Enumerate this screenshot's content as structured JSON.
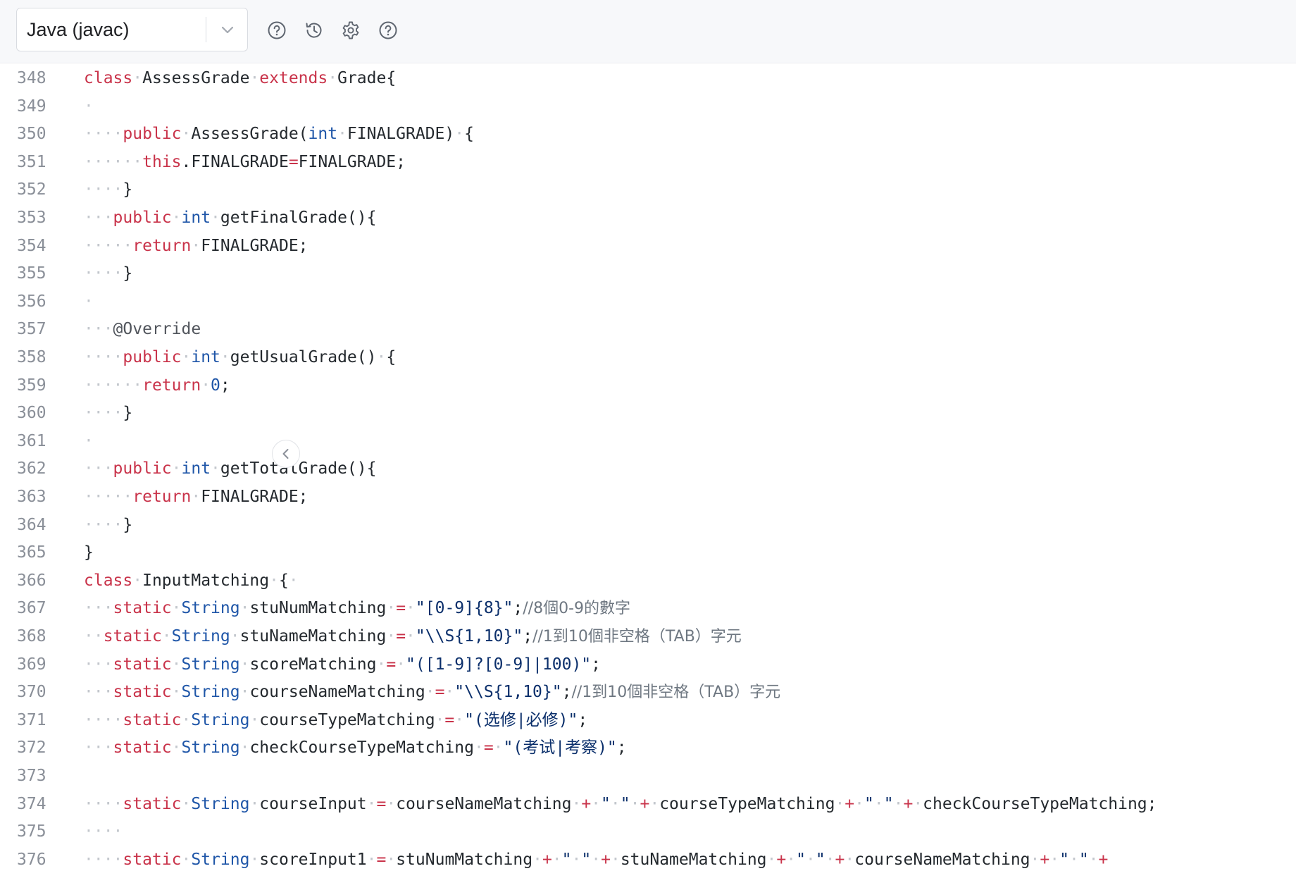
{
  "toolbar": {
    "language": "Java (javac)",
    "icons": [
      "help-circle-icon",
      "history-icon",
      "gear-icon",
      "question-icon"
    ]
  },
  "colors": {
    "keyword": "#c9334a",
    "type": "#1f56a8",
    "string": "#0b2f6b",
    "comment": "#6e7781",
    "whitespace": "#c3c7cd"
  },
  "editor": {
    "lines": [
      {
        "n": "348",
        "tokens": [
          [
            "kw",
            "class"
          ],
          [
            "ws",
            "·"
          ],
          [
            "pl",
            "AssessGrade"
          ],
          [
            "ws",
            "·"
          ],
          [
            "kw",
            "extends"
          ],
          [
            "ws",
            "·"
          ],
          [
            "pl",
            "Grade{"
          ]
        ]
      },
      {
        "n": "349",
        "tokens": [
          [
            "ws",
            "·"
          ]
        ]
      },
      {
        "n": "350",
        "tokens": [
          [
            "ws",
            "····"
          ],
          [
            "kw",
            "public"
          ],
          [
            "ws",
            "·"
          ],
          [
            "pl",
            "AssessGrade("
          ],
          [
            "ty",
            "int"
          ],
          [
            "ws",
            "·"
          ],
          [
            "pl",
            "FINALGRADE)"
          ],
          [
            "ws",
            "·"
          ],
          [
            "pl",
            "{"
          ]
        ]
      },
      {
        "n": "351",
        "tokens": [
          [
            "ws",
            "······"
          ],
          [
            "kw",
            "this"
          ],
          [
            "pl",
            ".FINALGRADE"
          ],
          [
            "op",
            "="
          ],
          [
            "pl",
            "FINALGRADE;"
          ]
        ]
      },
      {
        "n": "352",
        "tokens": [
          [
            "ws",
            "····"
          ],
          [
            "pl",
            "}"
          ]
        ]
      },
      {
        "n": "353",
        "tokens": [
          [
            "ws",
            "···"
          ],
          [
            "kw",
            "public"
          ],
          [
            "ws",
            "·"
          ],
          [
            "ty",
            "int"
          ],
          [
            "ws",
            "·"
          ],
          [
            "pl",
            "getFinalGrade(){"
          ]
        ]
      },
      {
        "n": "354",
        "tokens": [
          [
            "ws",
            "·····"
          ],
          [
            "kw",
            "return"
          ],
          [
            "ws",
            "·"
          ],
          [
            "pl",
            "FINALGRADE;"
          ]
        ]
      },
      {
        "n": "355",
        "tokens": [
          [
            "ws",
            "····"
          ],
          [
            "pl",
            "}"
          ]
        ]
      },
      {
        "n": "356",
        "tokens": [
          [
            "ws",
            "·"
          ]
        ]
      },
      {
        "n": "357",
        "tokens": [
          [
            "ws",
            "···"
          ],
          [
            "an",
            "@Override"
          ]
        ]
      },
      {
        "n": "358",
        "tokens": [
          [
            "ws",
            "····"
          ],
          [
            "kw",
            "public"
          ],
          [
            "ws",
            "·"
          ],
          [
            "ty",
            "int"
          ],
          [
            "ws",
            "·"
          ],
          [
            "pl",
            "getUsualGrade()"
          ],
          [
            "ws",
            "·"
          ],
          [
            "pl",
            "{"
          ]
        ]
      },
      {
        "n": "359",
        "tokens": [
          [
            "ws",
            "······"
          ],
          [
            "kw",
            "return"
          ],
          [
            "ws",
            "·"
          ],
          [
            "nu",
            "0"
          ],
          [
            "pl",
            ";"
          ]
        ]
      },
      {
        "n": "360",
        "tokens": [
          [
            "ws",
            "····"
          ],
          [
            "pl",
            "}"
          ]
        ]
      },
      {
        "n": "361",
        "tokens": [
          [
            "ws",
            "·"
          ]
        ]
      },
      {
        "n": "362",
        "tokens": [
          [
            "ws",
            "···"
          ],
          [
            "kw",
            "public"
          ],
          [
            "ws",
            "·"
          ],
          [
            "ty",
            "int"
          ],
          [
            "ws",
            "·"
          ],
          [
            "pl",
            "getTotalGrade(){"
          ]
        ]
      },
      {
        "n": "363",
        "tokens": [
          [
            "ws",
            "·····"
          ],
          [
            "kw",
            "return"
          ],
          [
            "ws",
            "·"
          ],
          [
            "pl",
            "FINALGRADE;"
          ]
        ]
      },
      {
        "n": "364",
        "tokens": [
          [
            "ws",
            "····"
          ],
          [
            "pl",
            "}"
          ]
        ]
      },
      {
        "n": "365",
        "tokens": [
          [
            "pl",
            "}"
          ]
        ]
      },
      {
        "n": "366",
        "tokens": [
          [
            "kw",
            "class"
          ],
          [
            "ws",
            "·"
          ],
          [
            "pl",
            "InputMatching"
          ],
          [
            "ws",
            "·"
          ],
          [
            "pl",
            "{"
          ],
          [
            "ws",
            "·"
          ]
        ]
      },
      {
        "n": "367",
        "tokens": [
          [
            "ws",
            "···"
          ],
          [
            "kw",
            "static"
          ],
          [
            "ws",
            "·"
          ],
          [
            "ty",
            "String"
          ],
          [
            "ws",
            "·"
          ],
          [
            "pl",
            "stuNumMatching"
          ],
          [
            "ws",
            "·"
          ],
          [
            "op",
            "="
          ],
          [
            "ws",
            "·"
          ],
          [
            "st",
            "\"[0-9]{8}\""
          ],
          [
            "pl",
            ";"
          ],
          [
            "cm",
            "//8個0-9的數字"
          ]
        ]
      },
      {
        "n": "368",
        "tokens": [
          [
            "ws",
            "··"
          ],
          [
            "kw",
            "static"
          ],
          [
            "ws",
            "·"
          ],
          [
            "ty",
            "String"
          ],
          [
            "ws",
            "·"
          ],
          [
            "pl",
            "stuNameMatching"
          ],
          [
            "ws",
            "·"
          ],
          [
            "op",
            "="
          ],
          [
            "ws",
            "·"
          ],
          [
            "st",
            "\"\\\\S{1,10}\""
          ],
          [
            "pl",
            ";"
          ],
          [
            "cm",
            "//1到10個非空格（TAB）字元"
          ]
        ]
      },
      {
        "n": "369",
        "tokens": [
          [
            "ws",
            "···"
          ],
          [
            "kw",
            "static"
          ],
          [
            "ws",
            "·"
          ],
          [
            "ty",
            "String"
          ],
          [
            "ws",
            "·"
          ],
          [
            "pl",
            "scoreMatching"
          ],
          [
            "ws",
            "·"
          ],
          [
            "op",
            "="
          ],
          [
            "ws",
            "·"
          ],
          [
            "st",
            "\"([1-9]?[0-9]|100)\""
          ],
          [
            "pl",
            ";"
          ]
        ]
      },
      {
        "n": "370",
        "tokens": [
          [
            "ws",
            "···"
          ],
          [
            "kw",
            "static"
          ],
          [
            "ws",
            "·"
          ],
          [
            "ty",
            "String"
          ],
          [
            "ws",
            "·"
          ],
          [
            "pl",
            "courseNameMatching"
          ],
          [
            "ws",
            "·"
          ],
          [
            "op",
            "="
          ],
          [
            "ws",
            "·"
          ],
          [
            "st",
            "\"\\\\S{1,10}\""
          ],
          [
            "pl",
            ";"
          ],
          [
            "cm",
            "//1到10個非空格（TAB）字元"
          ]
        ]
      },
      {
        "n": "371",
        "tokens": [
          [
            "ws",
            "····"
          ],
          [
            "kw",
            "static"
          ],
          [
            "ws",
            "·"
          ],
          [
            "ty",
            "String"
          ],
          [
            "ws",
            "·"
          ],
          [
            "pl",
            "courseTypeMatching"
          ],
          [
            "ws",
            "·"
          ],
          [
            "op",
            "="
          ],
          [
            "ws",
            "·"
          ],
          [
            "st",
            "\"(选修|必修)\""
          ],
          [
            "pl",
            ";"
          ]
        ]
      },
      {
        "n": "372",
        "tokens": [
          [
            "ws",
            "···"
          ],
          [
            "kw",
            "static"
          ],
          [
            "ws",
            "·"
          ],
          [
            "ty",
            "String"
          ],
          [
            "ws",
            "·"
          ],
          [
            "pl",
            "checkCourseTypeMatching"
          ],
          [
            "ws",
            "·"
          ],
          [
            "op",
            "="
          ],
          [
            "ws",
            "·"
          ],
          [
            "st",
            "\"(考试|考察)\""
          ],
          [
            "pl",
            ";"
          ]
        ]
      },
      {
        "n": "373",
        "tokens": []
      },
      {
        "n": "374",
        "tokens": [
          [
            "ws",
            "····"
          ],
          [
            "kw",
            "static"
          ],
          [
            "ws",
            "·"
          ],
          [
            "ty",
            "String"
          ],
          [
            "ws",
            "·"
          ],
          [
            "pl",
            "courseInput"
          ],
          [
            "ws",
            "·"
          ],
          [
            "op",
            "="
          ],
          [
            "ws",
            "·"
          ],
          [
            "pl",
            "courseNameMatching"
          ],
          [
            "ws",
            "·"
          ],
          [
            "op",
            "+"
          ],
          [
            "ws",
            "·"
          ],
          [
            "st",
            "\""
          ],
          [
            "ws",
            "·"
          ],
          [
            "st",
            "\""
          ],
          [
            "ws",
            "·"
          ],
          [
            "op",
            "+"
          ],
          [
            "ws",
            "·"
          ],
          [
            "pl",
            "courseTypeMatching"
          ],
          [
            "ws",
            "·"
          ],
          [
            "op",
            "+"
          ],
          [
            "ws",
            "·"
          ],
          [
            "st",
            "\""
          ],
          [
            "ws",
            "·"
          ],
          [
            "st",
            "\""
          ],
          [
            "ws",
            "·"
          ],
          [
            "op",
            "+"
          ],
          [
            "ws",
            "·"
          ],
          [
            "pl",
            "checkCourseTypeMatching;"
          ]
        ]
      },
      {
        "n": "375",
        "tokens": [
          [
            "ws",
            "····"
          ]
        ]
      },
      {
        "n": "376",
        "tokens": [
          [
            "ws",
            "····"
          ],
          [
            "kw",
            "static"
          ],
          [
            "ws",
            "·"
          ],
          [
            "ty",
            "String"
          ],
          [
            "ws",
            "·"
          ],
          [
            "pl",
            "scoreInput1"
          ],
          [
            "ws",
            "·"
          ],
          [
            "op",
            "="
          ],
          [
            "ws",
            "·"
          ],
          [
            "pl",
            "stuNumMatching"
          ],
          [
            "ws",
            "·"
          ],
          [
            "op",
            "+"
          ],
          [
            "ws",
            "·"
          ],
          [
            "st",
            "\""
          ],
          [
            "ws",
            "·"
          ],
          [
            "st",
            "\""
          ],
          [
            "ws",
            "·"
          ],
          [
            "op",
            "+"
          ],
          [
            "ws",
            "·"
          ],
          [
            "pl",
            "stuNameMatching"
          ],
          [
            "ws",
            "·"
          ],
          [
            "op",
            "+"
          ],
          [
            "ws",
            "·"
          ],
          [
            "st",
            "\""
          ],
          [
            "ws",
            "·"
          ],
          [
            "st",
            "\""
          ],
          [
            "ws",
            "·"
          ],
          [
            "op",
            "+"
          ],
          [
            "ws",
            "·"
          ],
          [
            "pl",
            "courseNameMatching"
          ],
          [
            "ws",
            "·"
          ],
          [
            "op",
            "+"
          ],
          [
            "ws",
            "·"
          ],
          [
            "st",
            "\""
          ],
          [
            "ws",
            "·"
          ],
          [
            "st",
            "\""
          ],
          [
            "ws",
            "·"
          ],
          [
            "op",
            "+"
          ]
        ]
      }
    ]
  }
}
